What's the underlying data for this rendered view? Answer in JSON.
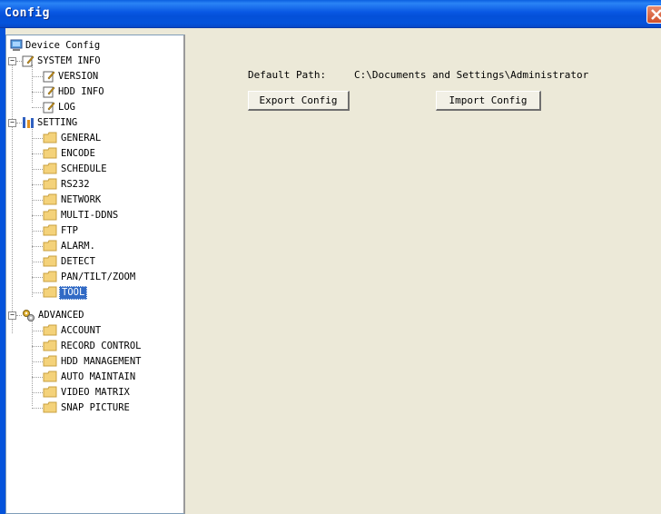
{
  "window": {
    "title": "Config"
  },
  "tree": {
    "root": "Device Config",
    "system_info": {
      "label": "SYSTEM INFO",
      "items": [
        "VERSION",
        "HDD INFO",
        "LOG"
      ]
    },
    "setting": {
      "label": "SETTING",
      "items": [
        "GENERAL",
        "ENCODE",
        "SCHEDULE",
        "RS232",
        "NETWORK",
        "MULTI-DDNS",
        "FTP",
        "ALARM.",
        "DETECT",
        "PAN/TILT/ZOOM",
        "TOOL"
      ]
    },
    "advanced": {
      "label": "ADVANCED",
      "items": [
        "ACCOUNT",
        "RECORD CONTROL",
        "HDD MANAGEMENT",
        "AUTO MAINTAIN",
        "VIDEO MATRIX",
        "SNAP PICTURE"
      ]
    },
    "selected": "TOOL"
  },
  "main": {
    "default_path_label": "Default Path:",
    "default_path_value": "C:\\Documents and Settings\\Administrator",
    "export_button": "Export Config",
    "import_button": "Import Config"
  }
}
